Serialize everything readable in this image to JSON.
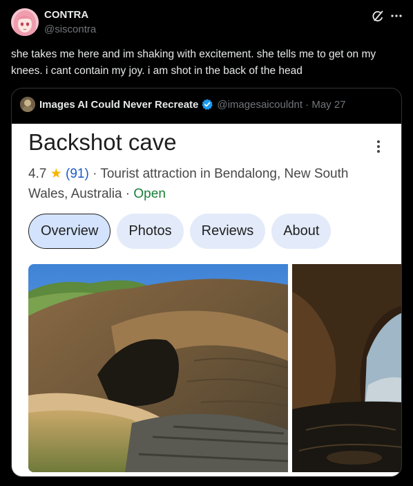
{
  "post": {
    "author_name": "CONTRA",
    "author_handle": "@siscontra",
    "text": "she takes me here and im shaking with excitement. she tells me to get on my knees. i cant contain my joy. i am shot in the back of the head",
    "icons": [
      "grok-icon",
      "more-icon"
    ]
  },
  "quote": {
    "author_name": "Images AI Could Never Recreate",
    "author_handle": "@imagesaicouldnt · May 27",
    "verified_color": "#1d9bf0"
  },
  "maps_card": {
    "title": "Backshot cave",
    "rating": "4.7",
    "review_count": "(91)",
    "category_line_1": " · Tourist attraction in Bendalong, New South",
    "category_line_2": "Wales, Australia · ",
    "status": "Open",
    "tabs": [
      {
        "label": "Overview",
        "active": true
      },
      {
        "label": "Photos",
        "active": false
      },
      {
        "label": "Reviews",
        "active": false
      },
      {
        "label": "About",
        "active": false
      }
    ],
    "colors": {
      "link": "#1a5bc8",
      "open": "#188038",
      "star": "#f6b400",
      "chip": "#e3eaf9"
    }
  }
}
